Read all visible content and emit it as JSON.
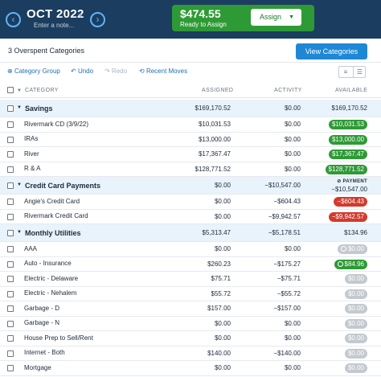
{
  "header": {
    "month": "OCT 2022",
    "note_placeholder": "Enter a note...",
    "ready_amount": "$474.55",
    "ready_label": "Ready to Assign",
    "assign_label": "Assign"
  },
  "overspent_text": "3 Overspent Categories",
  "view_categories_label": "View Categories",
  "toolbar": {
    "category_group": "Category Group",
    "undo": "Undo",
    "redo": "Redo",
    "recent_moves": "Recent Moves"
  },
  "columns": {
    "category": "CATEGORY",
    "assigned": "ASSIGNED",
    "activity": "ACTIVITY",
    "available": "AVAILABLE"
  },
  "rows": [
    {
      "group": true,
      "name": "Savings",
      "assigned": "$169,170.52",
      "activity": "$0.00",
      "available": "$169,170.52"
    },
    {
      "name": "Rivermark CD (3/9/22)",
      "assigned": "$10,031.53",
      "activity": "$0.00",
      "available": "$10,031.53",
      "pill": "green"
    },
    {
      "name": "IRAs",
      "assigned": "$13,000.00",
      "activity": "$0.00",
      "available": "$13,000.00",
      "pill": "green"
    },
    {
      "name": "River",
      "assigned": "$17,367.47",
      "activity": "$0.00",
      "available": "$17,367.47",
      "pill": "green"
    },
    {
      "name": "R & A",
      "assigned": "$128,771.52",
      "activity": "$0.00",
      "available": "$128,771.52",
      "pill": "green"
    },
    {
      "group": true,
      "name": "Credit Card Payments",
      "assigned": "$0.00",
      "activity": "−$10,547.00",
      "available": "−$10,547.00",
      "payment_label": "PAYMENT"
    },
    {
      "name": "Angie's Credit Card",
      "assigned": "$0.00",
      "activity": "−$604.43",
      "available": "−$604.43",
      "pill": "red"
    },
    {
      "name": "Rivermark Credit Card",
      "assigned": "$0.00",
      "activity": "−$9,942.57",
      "available": "−$9,942.57",
      "pill": "red"
    },
    {
      "group": true,
      "name": "Monthly Utilities",
      "assigned": "$5,313.47",
      "activity": "−$5,178.51",
      "available": "$134.96"
    },
    {
      "name": "AAA",
      "assigned": "$0.00",
      "activity": "$0.00",
      "available": "$0.00",
      "pill": "gray",
      "icon": true
    },
    {
      "name": "Auto - Insurance",
      "assigned": "$260.23",
      "activity": "−$175.27",
      "available": "$84.96",
      "pill": "green",
      "icon": true
    },
    {
      "name": "Electric - Delaware",
      "assigned": "$75.71",
      "activity": "−$75.71",
      "available": "$0.00",
      "pill": "gray"
    },
    {
      "name": "Electric - Nehalem",
      "assigned": "$55.72",
      "activity": "−$55.72",
      "available": "$0.00",
      "pill": "gray"
    },
    {
      "name": "Garbage - D",
      "assigned": "$157.00",
      "activity": "−$157.00",
      "available": "$0.00",
      "pill": "gray"
    },
    {
      "name": "Garbage - N",
      "assigned": "$0.00",
      "activity": "$0.00",
      "available": "$0.00",
      "pill": "gray"
    },
    {
      "name": "House Prep to Sell/Rent",
      "assigned": "$0.00",
      "activity": "$0.00",
      "available": "$0.00",
      "pill": "gray"
    },
    {
      "name": "Internet - Both",
      "assigned": "$140.00",
      "activity": "−$140.00",
      "available": "$0.00",
      "pill": "gray"
    },
    {
      "name": "Mortgage",
      "assigned": "$0.00",
      "activity": "$0.00",
      "available": "$0.00",
      "pill": "gray"
    }
  ],
  "colors": {
    "header_bg": "#1b3d5f",
    "ready_green": "#2e9a35",
    "accent_blue": "#1f88d6",
    "overspent_red": "#d33a2c",
    "zero_gray": "#c4c9cf",
    "group_row_bg": "#e8f3fb"
  }
}
